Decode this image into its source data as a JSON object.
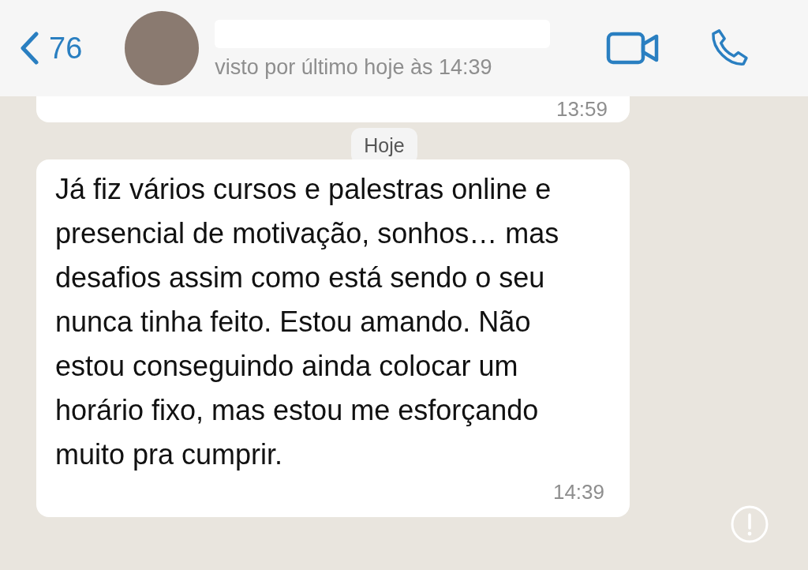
{
  "header": {
    "back_count": "76",
    "last_seen": "visto por último hoje às 14:39"
  },
  "previous_message": {
    "time": "13:59"
  },
  "date_separator": "Hoje",
  "message": {
    "text": "Já fiz vários cursos e palestras online e presencial de motivação, sonhos… mas desafios assim como está sendo o seu nunca tinha feito. Estou amando. Não estou conseguindo ainda colocar um horário fixo, mas estou me esforçando muito pra cumprir.",
    "time": "14:39"
  }
}
